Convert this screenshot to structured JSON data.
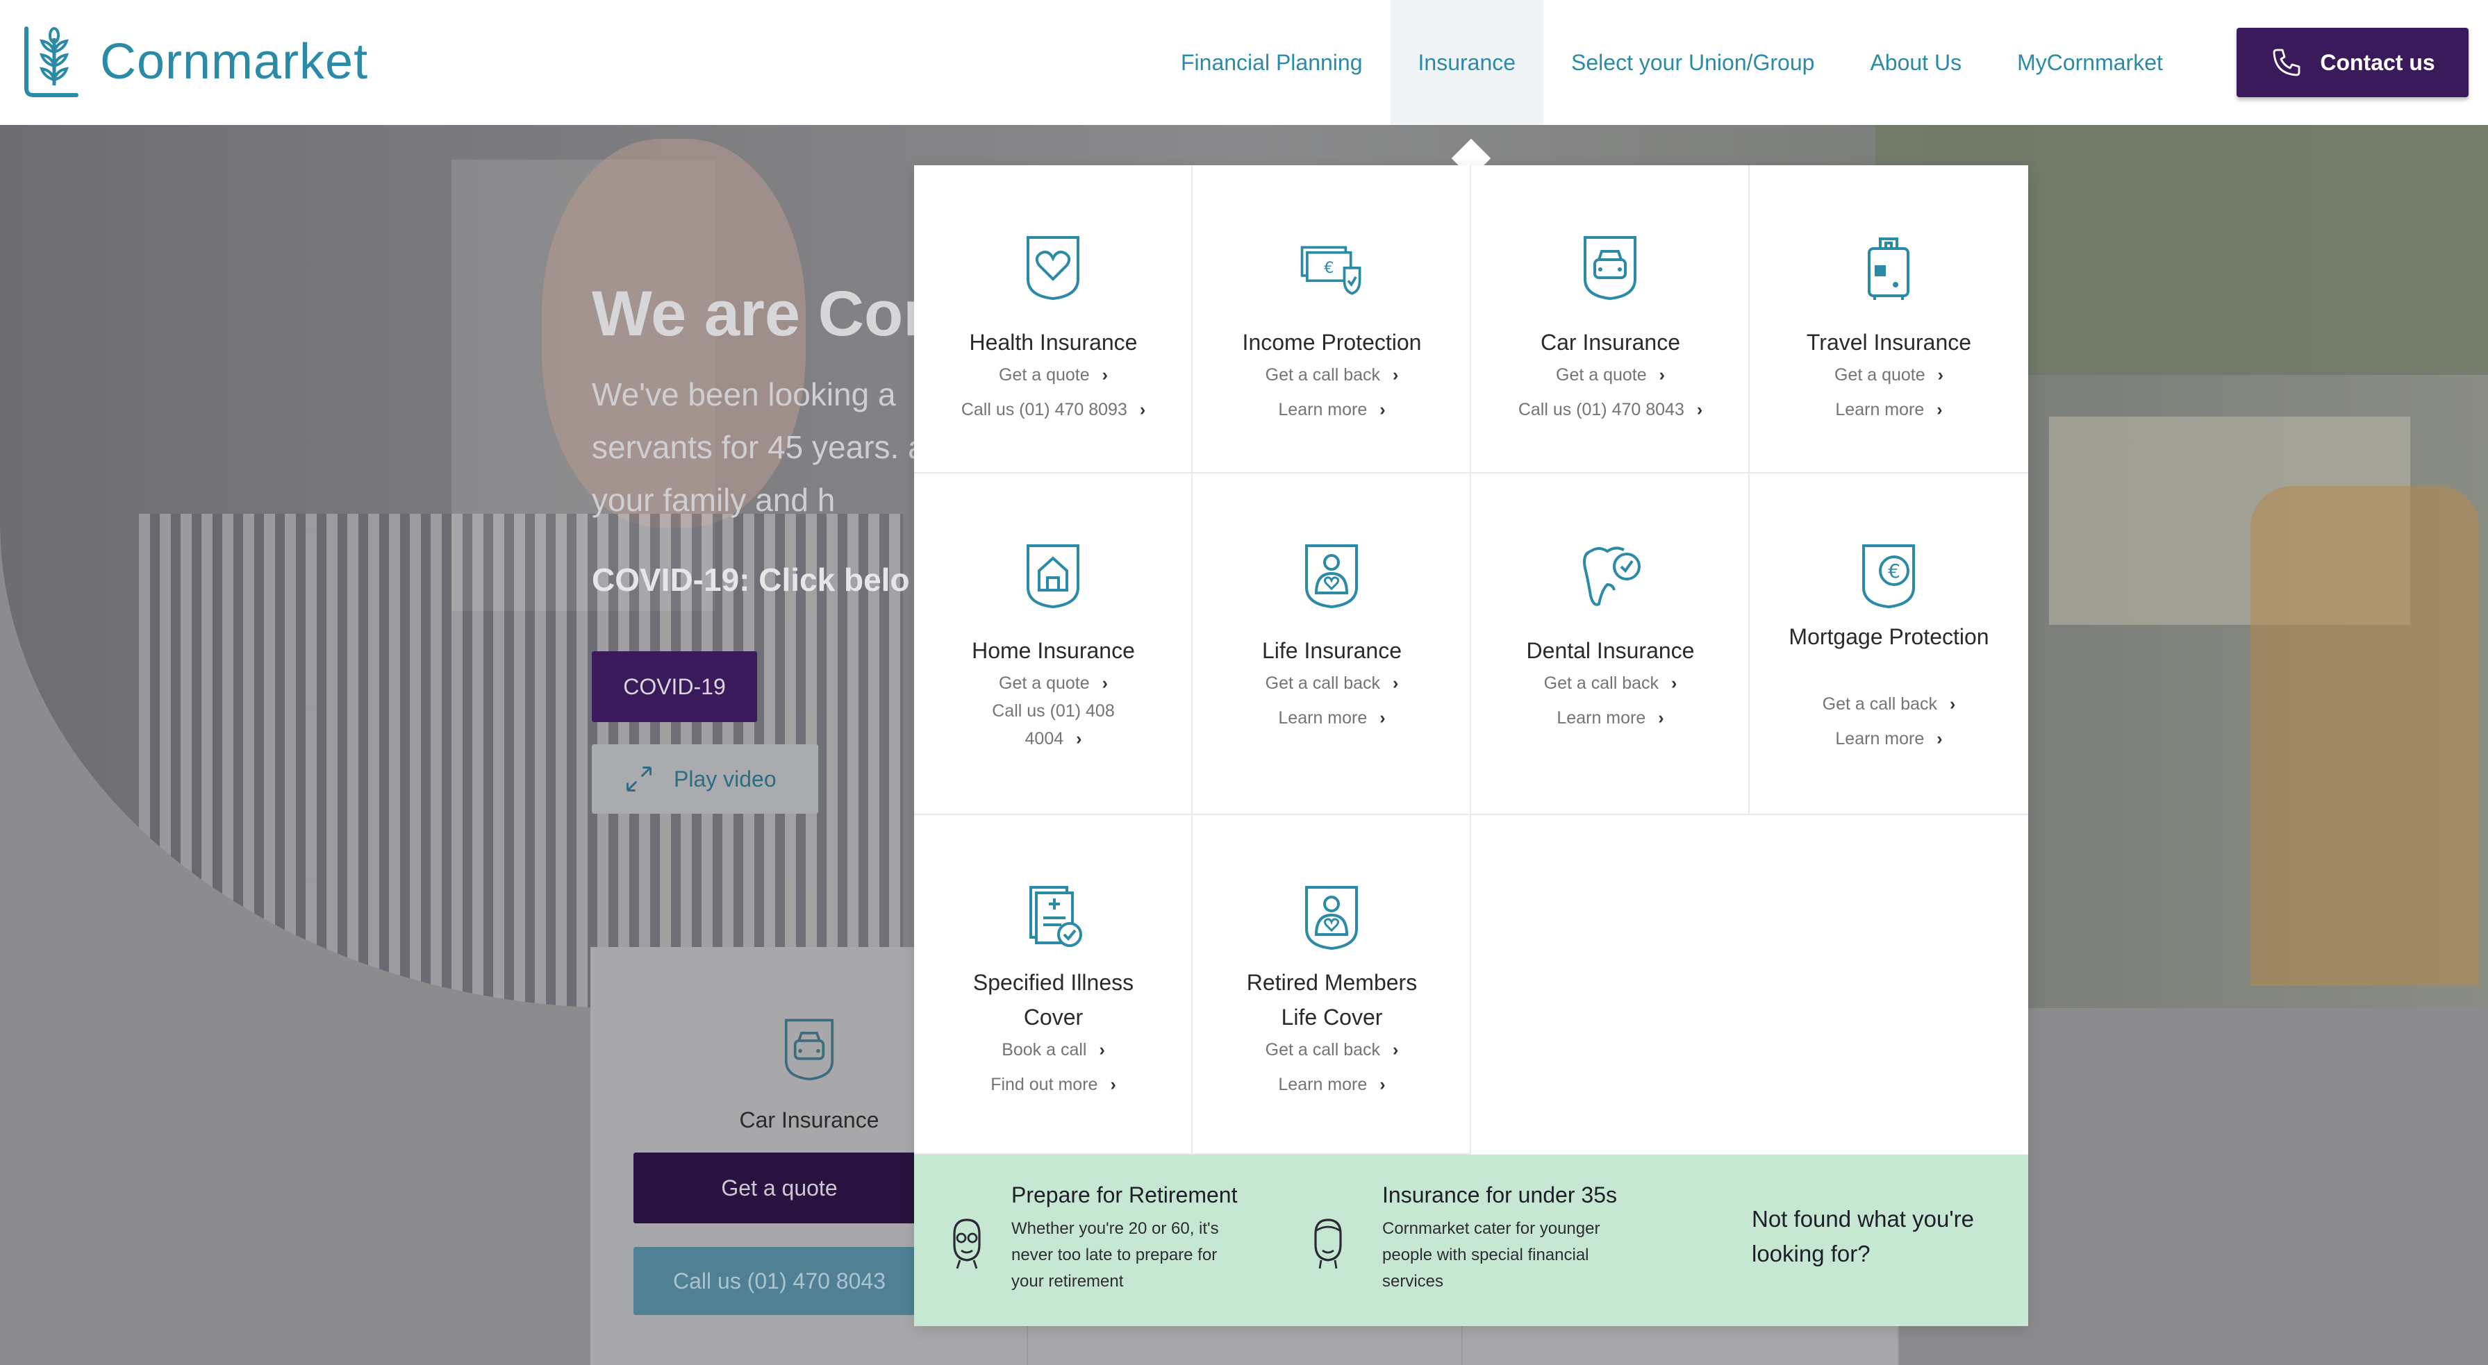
{
  "brand": {
    "name": "Cornmarket",
    "primary": "#2b8aa6",
    "purple": "#3b1a5c",
    "green": "#c6e7d1"
  },
  "nav": {
    "items": [
      {
        "label": "Financial Planning"
      },
      {
        "label": "Insurance"
      },
      {
        "label": "Select your Union/Group"
      },
      {
        "label": "About Us"
      },
      {
        "label": "MyCornmarket"
      }
    ],
    "active": "Insurance",
    "contact_label": "Contact us"
  },
  "hero": {
    "title": "We are Cor",
    "text": "We've been looking a servants for 45 years. and your family and h",
    "covid_heading": "COVID-19: Click belo",
    "covid_button": "COVID-19",
    "play_button": "Play video"
  },
  "lower_card": {
    "title": "Car Insurance",
    "quote_button": "Get a quote",
    "call_button": "Call us (01) 470 8043"
  },
  "menu": {
    "tiles": [
      {
        "icon": "health-heart-icon",
        "title": "Health Insurance",
        "links": [
          "Get a quote",
          "Call us (01) 470 8093"
        ]
      },
      {
        "icon": "income-cash-icon",
        "title": "Income Protection",
        "links": [
          "Get a call back",
          "Learn more"
        ]
      },
      {
        "icon": "car-icon",
        "title": "Car Insurance",
        "links": [
          "Get a quote",
          "Call us (01) 470 8043"
        ]
      },
      {
        "icon": "luggage-icon",
        "title": "Travel Insurance",
        "links": [
          "Get a quote",
          "Learn more"
        ]
      },
      {
        "icon": "house-icon",
        "title": "Home Insurance",
        "links": [
          "Get a quote",
          "Call us (01) 408 4004"
        ]
      },
      {
        "icon": "person-heart-icon",
        "title": "Life Insurance",
        "links": [
          "Get a call back",
          "Learn more"
        ]
      },
      {
        "icon": "tooth-icon",
        "title": "Dental Insurance",
        "links": [
          "Get a call back",
          "Learn more"
        ]
      },
      {
        "icon": "euro-document-icon",
        "title": "Mortgage Protection",
        "links": [
          "Get a call back",
          "Learn more"
        ]
      },
      {
        "icon": "clipboard-check-icon",
        "title": "Specified Illness Cover",
        "links": [
          "Book a call",
          "Find out more"
        ]
      },
      {
        "icon": "person-heart-icon",
        "title": "Retired Members Life Cover",
        "links": [
          "Get a call back",
          "Learn more"
        ]
      }
    ],
    "footer": [
      {
        "icon": "retiree-face-icon",
        "title": "Prepare for Retirement",
        "desc": "Whether you're 20 or 60, it's never too late to prepare for your retirement"
      },
      {
        "icon": "young-face-icon",
        "title": "Insurance for under 35s",
        "desc": "Cornmarket cater for younger people with special financial services"
      }
    ],
    "not_found": "Not found what you're looking for?"
  }
}
